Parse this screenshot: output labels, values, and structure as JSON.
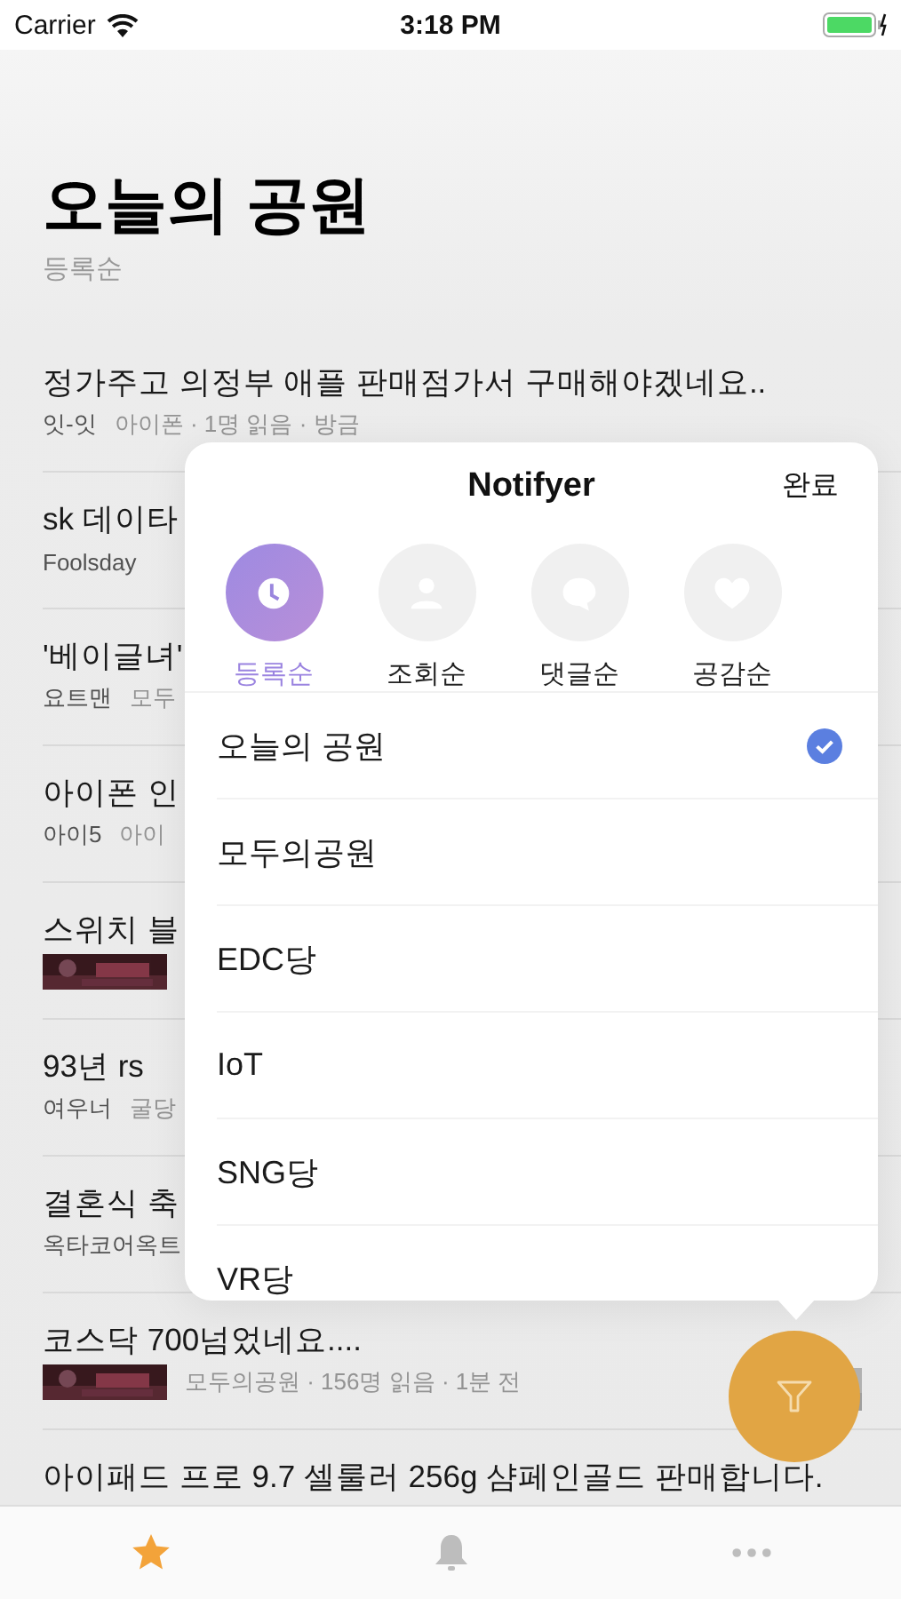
{
  "status_bar": {
    "carrier": "Carrier",
    "time": "3:18 PM"
  },
  "header": {
    "title": "오늘의 공원",
    "subtitle": "등록순"
  },
  "posts": [
    {
      "title": "정가주고 의정부 애플 판매점가서 구매해야겠네요..",
      "author": "잇-잇",
      "meta": "아이폰 · 1명 읽음 · 방금",
      "thumbnail": false,
      "side_thumbnail": false
    },
    {
      "title": "sk 데이타",
      "author": "Foolsday",
      "thumbnail": false,
      "side_thumbnail": false
    },
    {
      "title": "'베이글녀'",
      "author": "요트맨",
      "meta": "모두",
      "thumbnail": false,
      "side_thumbnail": false
    },
    {
      "title": "아이폰 인",
      "author": "아이5",
      "meta": "아이",
      "thumbnail": false,
      "side_thumbnail": false
    },
    {
      "title": "스위치 블",
      "thumbnail": true,
      "side_thumbnail": false
    },
    {
      "title": "93년 rs",
      "author": "여우너",
      "meta": "굴당",
      "thumbnail": false,
      "side_thumbnail": false
    },
    {
      "title": "결혼식 축",
      "author": "옥타코어옥트",
      "thumbnail": false,
      "side_thumbnail": false
    },
    {
      "title": "코스닥 700넘었네요....",
      "meta": "모두의공원 · 156명 읽음 · 1분 전",
      "thumbnail": true,
      "side_thumbnail": true
    },
    {
      "title": "아이패드 프로 9.7 셀룰러 256g 샴페인골드 판매합니다.",
      "thumbnail": false,
      "side_thumbnail": false
    }
  ],
  "popover": {
    "title": "Notifyer",
    "done": "완료",
    "sort_options": [
      {
        "kind": "clock",
        "label": "등록순",
        "selected": true
      },
      {
        "kind": "person",
        "label": "조회순",
        "selected": false
      },
      {
        "kind": "comment",
        "label": "댓글순",
        "selected": false
      },
      {
        "kind": "heart",
        "label": "공감순",
        "selected": false
      }
    ],
    "boards": [
      {
        "name": "오늘의 공원",
        "checked": true
      },
      {
        "name": "모두의공원",
        "checked": false
      },
      {
        "name": "EDC당",
        "checked": false
      },
      {
        "name": "IoT",
        "checked": false
      },
      {
        "name": "SNG당",
        "checked": false
      },
      {
        "name": "VR당",
        "checked": false
      }
    ]
  },
  "tab_bar": [
    {
      "kind": "star",
      "selected": true
    },
    {
      "kind": "bell",
      "selected": false
    },
    {
      "kind": "more",
      "selected": false
    }
  ]
}
